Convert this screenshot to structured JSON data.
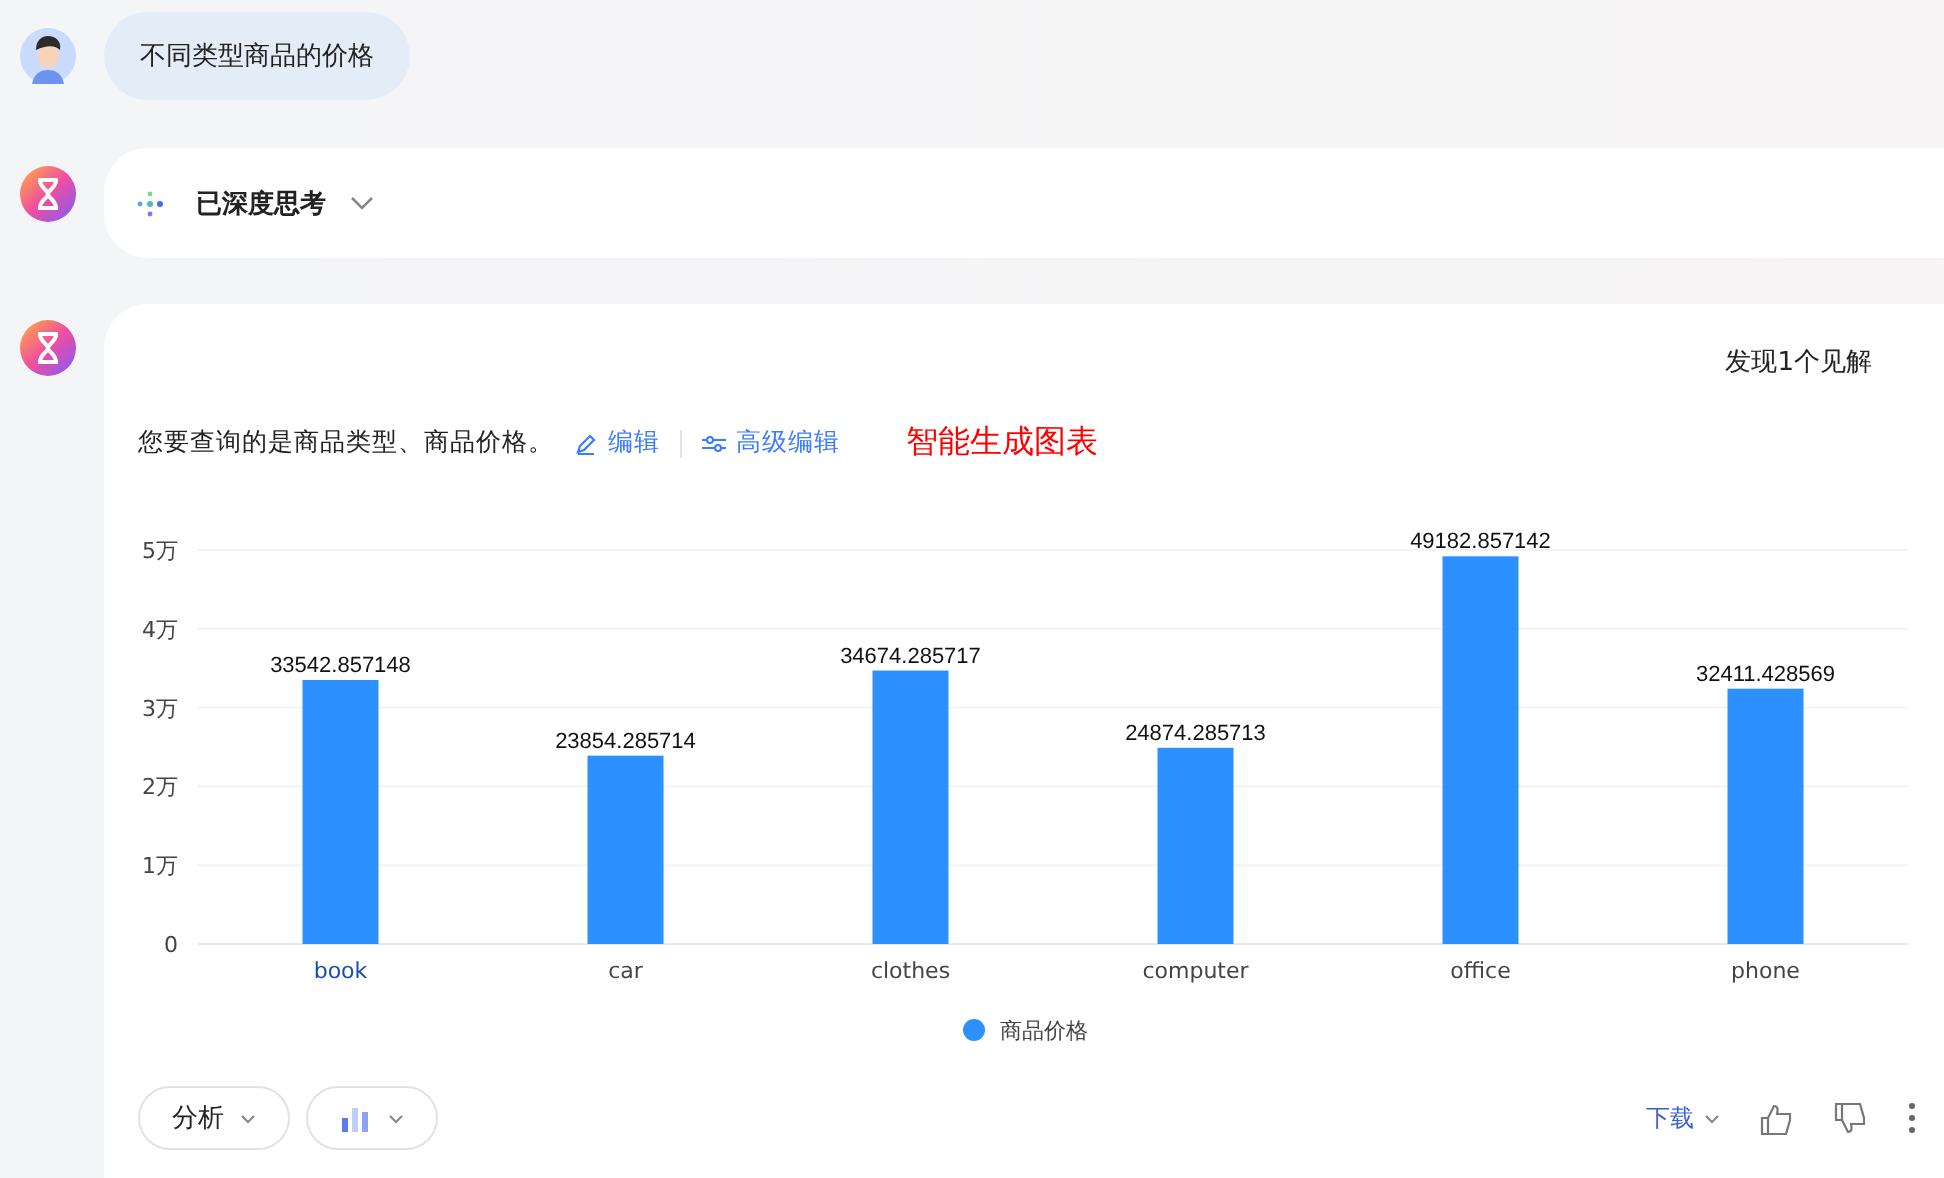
{
  "user_message": {
    "text": "不同类型商品的价格"
  },
  "thinking": {
    "label": "已深度思考",
    "expanded": false
  },
  "answer": {
    "insight": "发现1个见解",
    "query_text": "您要查询的是商品类型、商品价格。",
    "edit_link": "编辑",
    "advanced_edit_link": "高级编辑",
    "generated_note": "智能生成图表",
    "chart_data": {
      "type": "bar",
      "categories": [
        "book",
        "car",
        "clothes",
        "computer",
        "office",
        "phone"
      ],
      "series": [
        {
          "name": "商品价格",
          "color": "#2c91ff",
          "values": [
            3.35,
            2.39,
            3.47,
            2.49,
            4.92,
            3.24
          ]
        }
      ],
      "value_labels": [
        "33542.857148",
        "23854.285714",
        "34674.285717",
        "24874.285713",
        "49182.857142",
        "32411.428569"
      ],
      "ylim": [
        0,
        5
      ],
      "grid": true,
      "yticks": [
        {
          "value": 0,
          "label": "0"
        },
        {
          "value": 1,
          "label": "1万"
        },
        {
          "value": 2,
          "label": "2万"
        },
        {
          "value": 3,
          "label": "3万"
        },
        {
          "value": 4,
          "label": "4万"
        },
        {
          "value": 5,
          "label": "5万"
        }
      ]
    },
    "analyze_button": "分析",
    "download_button": "下载"
  }
}
